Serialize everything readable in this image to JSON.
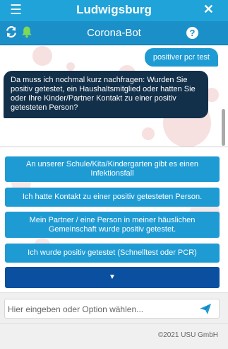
{
  "header": {
    "menu_icon": "hamburger-icon",
    "title": "Ludwigsburg",
    "close_icon": "close-icon",
    "color": "#1fa3d9"
  },
  "subheader": {
    "refresh_icon": "refresh-icon",
    "bell_icon": "bell-icon",
    "title": "Corona-Bot",
    "help_icon": "help-icon",
    "help_glyph": "?",
    "color": "#1b8fc8"
  },
  "chat": {
    "user_message": "positiver pcr test",
    "bot_message": "Da muss ich nochmal kurz nachfragen: Wurden Sie positiv getestet, ein Haushaltsmitglied oder hatten Sie oder Ihre Kinder/Partner Kontakt zu einer positiv getesteten Person?"
  },
  "options": [
    {
      "label": "An unserer Schule/Kita/Kindergarten gibt es einen Infektionsfall"
    },
    {
      "label": "Ich hatte Kontakt zu einer positiv getesteten Person."
    },
    {
      "label": "Mein Partner / eine Person in meiner häuslichen Gemeinschaft wurde positiv getestet."
    },
    {
      "label": "Ich wurde positiv getestet (Schnelltest oder PCR)"
    }
  ],
  "more_options": {
    "icon": "caret-down-icon",
    "glyph": "▼"
  },
  "input": {
    "placeholder": "Hier eingeben oder Option wählen...",
    "value": "",
    "send_icon": "send-icon"
  },
  "footer": {
    "copyright": "©2021 USU GmbH"
  }
}
